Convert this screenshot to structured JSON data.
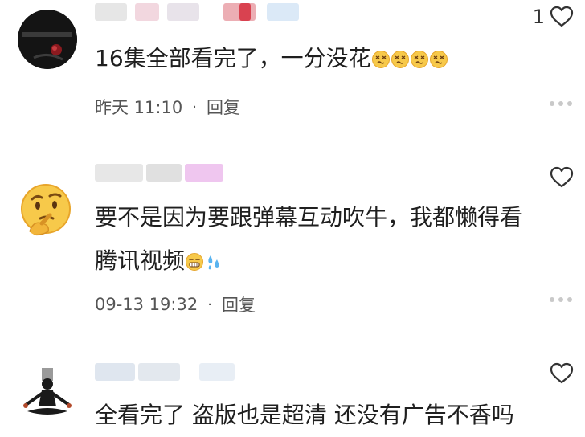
{
  "comments": [
    {
      "avatar_icon": "dark-photo-avatar",
      "likes": "1",
      "text": "16集全部看完了，一分没花",
      "emojis": [
        "dizzy-face-icon",
        "dizzy-face-icon",
        "dizzy-face-icon",
        "dizzy-face-icon"
      ],
      "time": "昨天 11:10",
      "reply": "回复"
    },
    {
      "avatar_icon": "thinking-face-avatar",
      "likes": "",
      "text_line1": "要不是因为要跟弹幕互动吹牛，我都懒得看",
      "text_line2": "腾讯视频",
      "emojis": [
        "grimace-face-icon",
        "sweat-drops-icon"
      ],
      "time": "09-13 19:32",
      "reply": "回复"
    },
    {
      "avatar_icon": "meditating-figure-avatar",
      "likes": "",
      "text": "全看完了  盗版也是超清 还没有广告不香吗"
    }
  ],
  "colors": {
    "text": "#1f1f1f",
    "meta": "#555555",
    "icon": "#333333",
    "emoji_yellow": "#f7c94a"
  }
}
